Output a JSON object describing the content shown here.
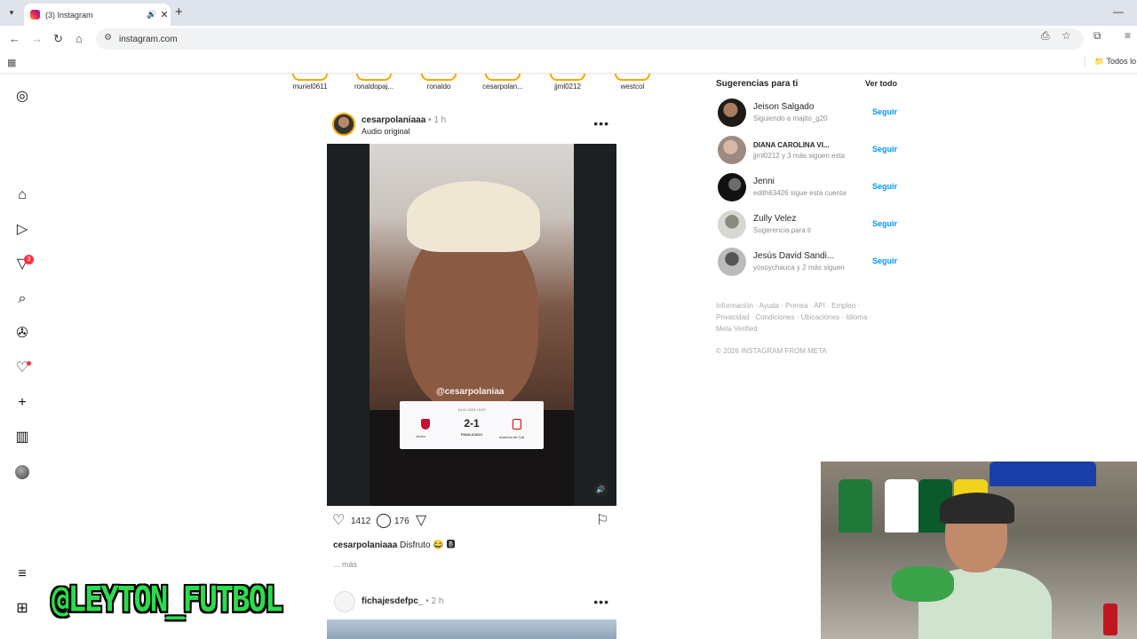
{
  "browser": {
    "tab_title": "(3) Instagram",
    "tab_menu_icon": "chevron-down-icon",
    "newtab_label": "+",
    "url": "instagram.com",
    "all_bookmarks": "Todos lo",
    "window_controls": [
      "—",
      "❐"
    ]
  },
  "sidebar": {
    "notification_badge": "3"
  },
  "watermark": "@LEYTON_FUTBOL",
  "stories": [
    "muriel0611",
    "ronaldopaj...",
    "ronaldo",
    "cesarpolan...",
    "jjml0212",
    "westcol"
  ],
  "post": {
    "username": "cesarpolaniaaa",
    "time": "• 1 h",
    "audio": "Audio original",
    "more": "•••",
    "overlay_handle": "@cesarpolaniaa",
    "score_date": "18.02.2026 19:00",
    "score": "2-1",
    "score_status": "FINALIZADO",
    "home_team": "Junior",
    "away_team": "América de Cali",
    "likes": "1412",
    "comments": "176",
    "caption_user": "cesarpolaniaaa",
    "caption_text": "Disfruto 😂 🅱",
    "more_link": "... más"
  },
  "post2": {
    "username": "fichajesdefpc_",
    "time": "• 2 h",
    "more": "•••"
  },
  "suggestions": {
    "title": "Sugerencias para ti",
    "see_all": "Ver todo",
    "follow_label": "Seguir",
    "items": [
      {
        "name": "Jeison Salgado",
        "desc": "Siguiendo a majito_g20"
      },
      {
        "name": "DIANA CAROLINA VI...",
        "desc": "jjml0212 y 3 más siguen esta"
      },
      {
        "name": "Jenni",
        "desc": "edith63426 sigue esta cuenta"
      },
      {
        "name": "Zully Velez",
        "desc": "Sugerencia para ti"
      },
      {
        "name": "Jesús David Sandi...",
        "desc": "yosoychauca y 2 más siguen"
      }
    ]
  },
  "footer": {
    "links": "Información · Ayuda · Prensa · API · Empleo · Privacidad · Condiciones · Ubicaciones · Idioma · Meta Verified",
    "copyright": "© 2026 INSTAGRAM FROM META"
  }
}
